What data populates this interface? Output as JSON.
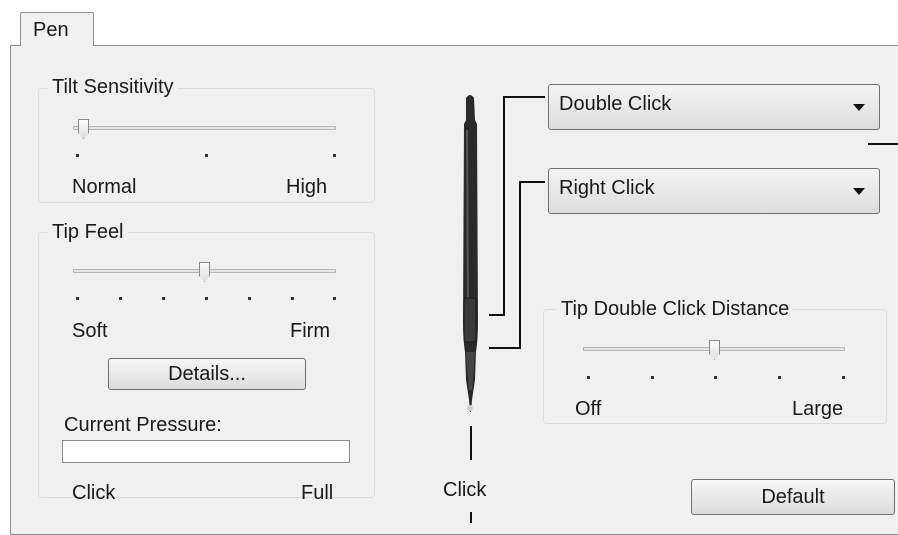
{
  "tab": {
    "label": "Pen"
  },
  "tilt": {
    "title": "Tilt Sensitivity",
    "min_label": "Normal",
    "max_label": "High",
    "level": 0
  },
  "tip_feel": {
    "title": "Tip Feel",
    "min_label": "Soft",
    "max_label": "Firm",
    "level": 0.5,
    "details_button": "Details...",
    "pressure_label": "Current Pressure:",
    "pressure_min": "Click",
    "pressure_max": "Full"
  },
  "pen": {
    "upper_button": "Double Click",
    "lower_button": "Right Click",
    "tip": "Click"
  },
  "double_click_distance": {
    "title": "Tip Double Click Distance",
    "min_label": "Off",
    "max_label": "Large",
    "level": 0.5
  },
  "default_button": "Default"
}
